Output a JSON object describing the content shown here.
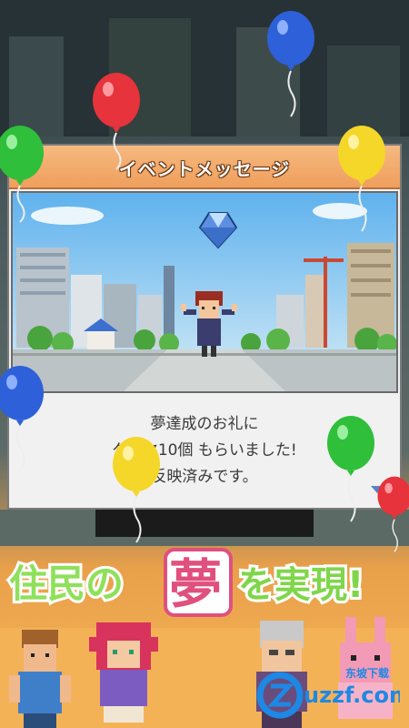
{
  "dialog": {
    "title": "イベントメッセージ",
    "message_lines": [
      "夢達成のお礼に",
      "ダイヤ10個 もらいました!",
      "反映済みです。"
    ]
  },
  "banner": {
    "part1": "住民の",
    "part2": "夢",
    "part3": "を実現!"
  },
  "watermark": {
    "text_top": "东坡下载",
    "text_main": "uzzf.com"
  },
  "colors": {
    "dialog_header": "#ef9f5c",
    "banner_green": "#7fd64a",
    "banner_pink": "#e0507e",
    "balloon_red": "#e7333b",
    "balloon_blue": "#2d60d9",
    "balloon_green": "#2fbf3a",
    "balloon_yellow": "#f4d728"
  },
  "icons": [
    "diamond-icon",
    "balloon-icon",
    "next-arrow-icon"
  ]
}
